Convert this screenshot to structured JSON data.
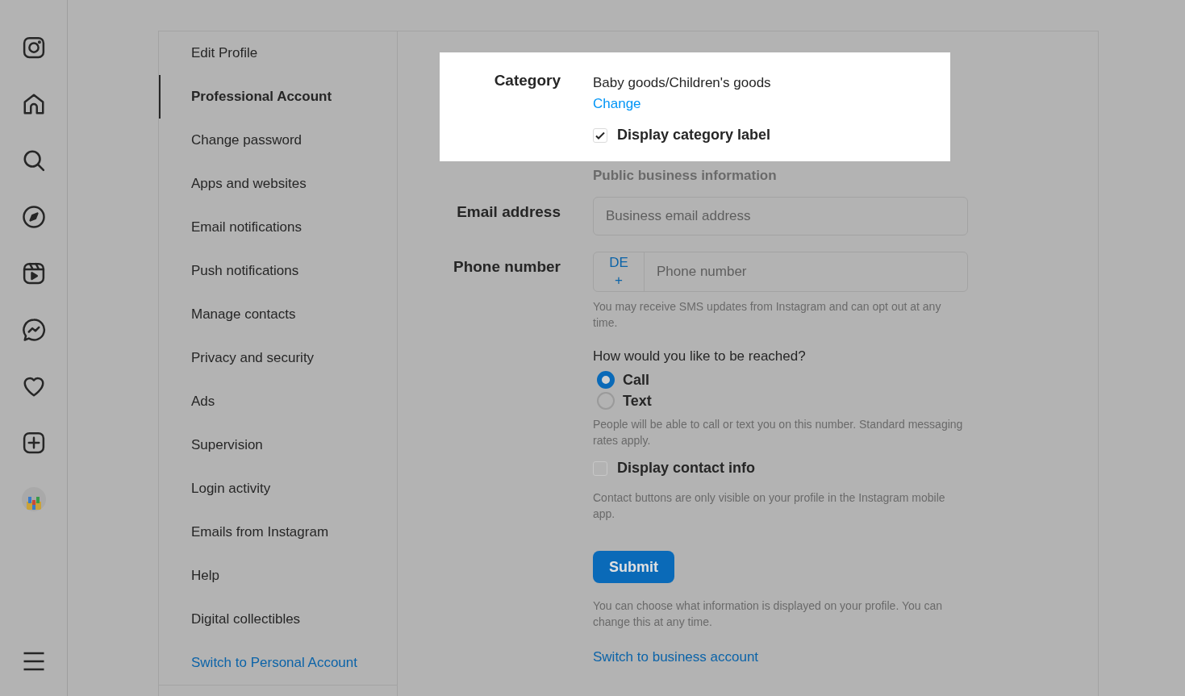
{
  "settings_menu": {
    "items": [
      {
        "label": "Edit Profile",
        "selected": false
      },
      {
        "label": "Professional Account",
        "selected": true
      },
      {
        "label": "Change password",
        "selected": false
      },
      {
        "label": "Apps and websites",
        "selected": false
      },
      {
        "label": "Email notifications",
        "selected": false
      },
      {
        "label": "Push notifications",
        "selected": false
      },
      {
        "label": "Manage contacts",
        "selected": false
      },
      {
        "label": "Privacy and security",
        "selected": false
      },
      {
        "label": "Ads",
        "selected": false
      },
      {
        "label": "Supervision",
        "selected": false
      },
      {
        "label": "Login activity",
        "selected": false
      },
      {
        "label": "Emails from Instagram",
        "selected": false
      },
      {
        "label": "Help",
        "selected": false
      },
      {
        "label": "Digital collectibles",
        "selected": false
      }
    ],
    "footer_link": "Switch to Personal Account"
  },
  "category": {
    "highlighted": true,
    "label": "Category",
    "value": "Baby goods/Children's goods",
    "change_link": "Change",
    "display_label": {
      "label": "Display category label",
      "checked": true
    }
  },
  "section_heading": "Public business information",
  "email": {
    "label": "Email address",
    "placeholder": "Business email address"
  },
  "phone": {
    "label": "Phone number",
    "country_code": "DE",
    "country_plus": "+",
    "placeholder": "Phone number",
    "hint": "You may receive SMS updates from Instagram and can opt out at any time."
  },
  "reach": {
    "question": "How would you like to be reached?",
    "options": [
      {
        "label": "Call",
        "selected": true
      },
      {
        "label": "Text",
        "selected": false
      }
    ],
    "hint": "People will be able to call or text you on this number. Standard messaging rates apply."
  },
  "display_contact": {
    "label": "Display contact info",
    "checked": false,
    "hint": "Contact buttons are only visible on your profile in the Instagram mobile app."
  },
  "submit": "Submit",
  "note": "You can choose what information is displayed on your profile. You can change this at any time.",
  "switch_link": "Switch to business account"
}
